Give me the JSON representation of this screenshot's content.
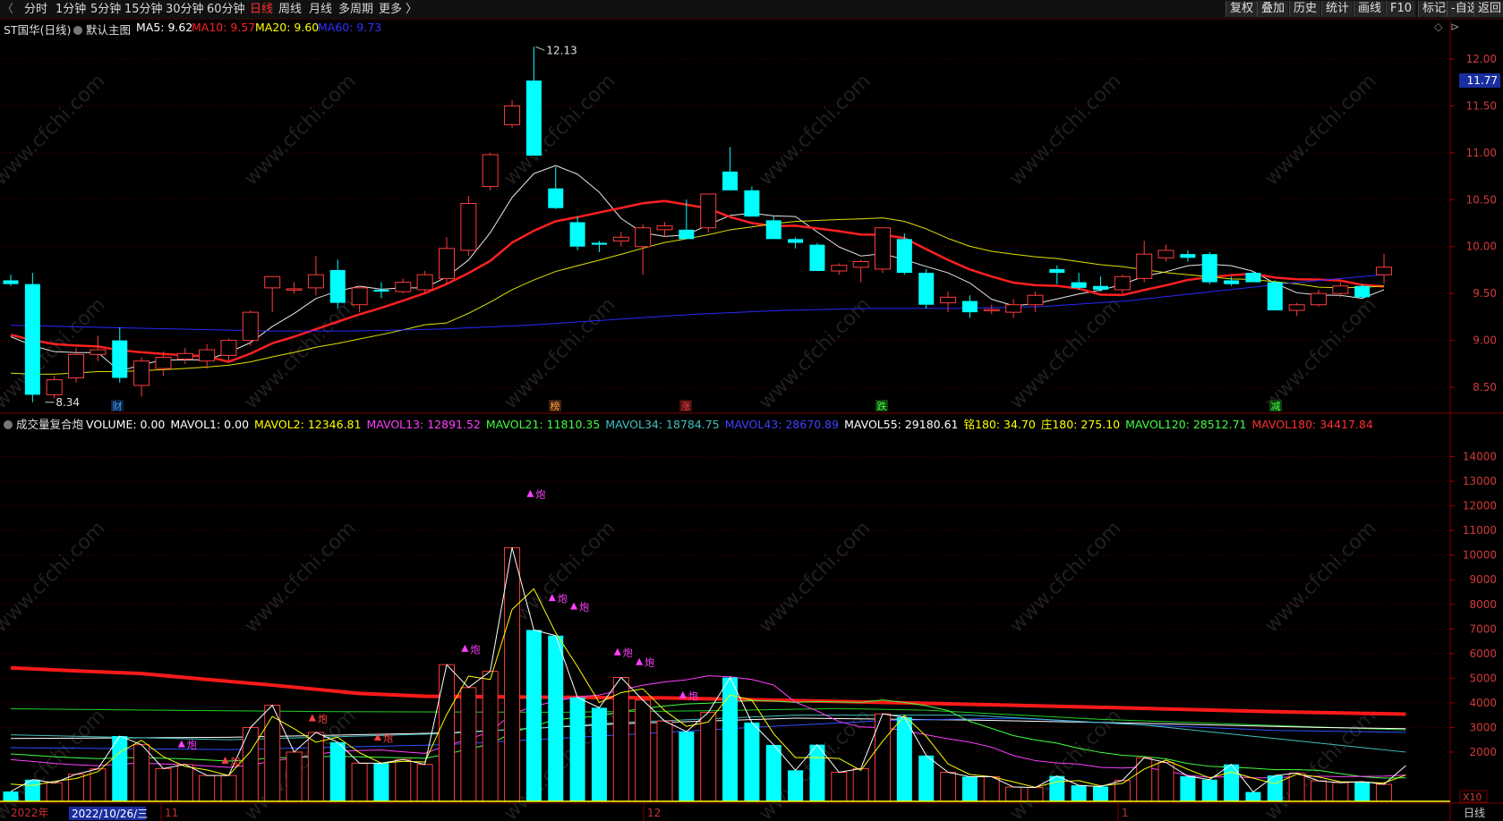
{
  "toolbar": {
    "periods": [
      "分时",
      "1分钟",
      "5分钟",
      "15分钟",
      "30分钟",
      "60分钟",
      "日线",
      "周线",
      "月线",
      "多周期",
      "更多 〉"
    ],
    "active_period": "日线",
    "right_buttons": [
      "复权",
      "叠加",
      "历史",
      "统计",
      "画线",
      "F10",
      "标记",
      "-自选",
      "返回"
    ]
  },
  "main": {
    "title": "ST国华(日线)",
    "indicator": "默认主图",
    "ma": [
      {
        "label": "MA5: 9.62",
        "color": "#ffffff"
      },
      {
        "label": "MA10: 9.57",
        "color": "#ff2020"
      },
      {
        "label": "MA20: 9.60",
        "color": "#ffff00"
      },
      {
        "label": "MA60: 9.73",
        "color": "#3030ff"
      }
    ],
    "high_label": "12.13",
    "low_label": "8.34",
    "last_price": "11.77",
    "price_ticks": [
      "12.00",
      "11.50",
      "11.00",
      "10.50",
      "10.00",
      "9.50",
      "9.00",
      "8.50"
    ],
    "events": [
      {
        "text": "财",
        "color": "#40a0ff",
        "bg": "#102040"
      },
      {
        "text": "榜",
        "color": "#ffa040",
        "bg": "#402010"
      },
      {
        "text": "涨",
        "color": "#ff4040",
        "bg": "#401010"
      },
      {
        "text": "跌",
        "color": "#40ff40",
        "bg": "#104010"
      },
      {
        "text": "减",
        "color": "#40ff40",
        "bg": "#104010"
      }
    ]
  },
  "volume": {
    "title": "成交量复合炮",
    "values": [
      {
        "label": "VOLUME: 0.00",
        "color": "#ffffff"
      },
      {
        "label": "MAVOL1: 0.00",
        "color": "#ffffff"
      },
      {
        "label": "MAVOL2: 12346.81",
        "color": "#ffff00"
      },
      {
        "label": "MAVOL13: 12891.52",
        "color": "#ff40ff"
      },
      {
        "label": "MAVOL21: 11810.35",
        "color": "#40ff40"
      },
      {
        "label": "MAVOL34: 18784.75",
        "color": "#40c0c0"
      },
      {
        "label": "MAVOL43: 28670.89",
        "color": "#4040ff"
      },
      {
        "label": "MAVOL55: 29180.61",
        "color": "#ffffff"
      },
      {
        "label": "铭180: 34.70",
        "color": "#ffff00"
      },
      {
        "label": "庄180: 275.10",
        "color": "#ffff00"
      },
      {
        "label": "MAVOL120: 28512.71",
        "color": "#40ff40"
      },
      {
        "label": "MAVOL180: 34417.84",
        "color": "#ff3030"
      }
    ],
    "ticks": [
      "14000",
      "13000",
      "12000",
      "11000",
      "10000",
      "9000",
      "8000",
      "7000",
      "6000",
      "5000",
      "4000",
      "3000",
      "2000"
    ],
    "multiplier": "X10",
    "marker_labels": [
      "炮",
      "加",
      "炮",
      "炮",
      "炮",
      "炮",
      "炮",
      "炮",
      "炮",
      "炮",
      "炮"
    ]
  },
  "dates": {
    "year": "2022年",
    "cursor": "2022/10/26/三",
    "months": [
      "11",
      "12",
      "1"
    ],
    "period": "日线"
  },
  "watermark": "www.cfchi.com",
  "chart_data": {
    "type": "candlestick",
    "bars": [
      {
        "o": 9.64,
        "h": 9.7,
        "l": 9.58,
        "c": 9.6
      },
      {
        "o": 9.6,
        "h": 9.72,
        "l": 8.34,
        "c": 8.42
      },
      {
        "o": 8.42,
        "h": 8.62,
        "l": 8.38,
        "c": 8.58
      },
      {
        "o": 8.6,
        "h": 8.92,
        "l": 8.55,
        "c": 8.85
      },
      {
        "o": 8.85,
        "h": 9.05,
        "l": 8.78,
        "c": 8.9
      },
      {
        "o": 9.0,
        "h": 9.14,
        "l": 8.55,
        "c": 8.6
      },
      {
        "o": 8.52,
        "h": 8.82,
        "l": 8.4,
        "c": 8.78
      },
      {
        "o": 8.7,
        "h": 8.88,
        "l": 8.62,
        "c": 8.82
      },
      {
        "o": 8.8,
        "h": 8.92,
        "l": 8.75,
        "c": 8.86
      },
      {
        "o": 8.78,
        "h": 8.96,
        "l": 8.7,
        "c": 8.9
      },
      {
        "o": 8.84,
        "h": 9.02,
        "l": 8.78,
        "c": 9.0
      },
      {
        "o": 9.0,
        "h": 9.32,
        "l": 8.94,
        "c": 9.3
      },
      {
        "o": 9.56,
        "h": 9.68,
        "l": 9.3,
        "c": 9.68
      },
      {
        "o": 9.54,
        "h": 9.62,
        "l": 9.5,
        "c": 9.55
      },
      {
        "o": 9.56,
        "h": 9.9,
        "l": 9.48,
        "c": 9.7
      },
      {
        "o": 9.75,
        "h": 9.86,
        "l": 9.34,
        "c": 9.4
      },
      {
        "o": 9.38,
        "h": 9.58,
        "l": 9.3,
        "c": 9.56
      },
      {
        "o": 9.54,
        "h": 9.62,
        "l": 9.45,
        "c": 9.52
      },
      {
        "o": 9.52,
        "h": 9.66,
        "l": 9.5,
        "c": 9.62
      },
      {
        "o": 9.54,
        "h": 9.74,
        "l": 9.5,
        "c": 9.7
      },
      {
        "o": 9.66,
        "h": 10.1,
        "l": 9.6,
        "c": 9.98
      },
      {
        "o": 9.96,
        "h": 10.54,
        "l": 9.9,
        "c": 10.46
      },
      {
        "o": 10.64,
        "h": 11.0,
        "l": 10.6,
        "c": 10.98
      },
      {
        "o": 11.3,
        "h": 11.56,
        "l": 11.26,
        "c": 11.5
      },
      {
        "o": 11.77,
        "h": 12.13,
        "l": 10.97,
        "c": 10.97
      },
      {
        "o": 10.62,
        "h": 10.85,
        "l": 10.4,
        "c": 10.41
      },
      {
        "o": 10.26,
        "h": 10.32,
        "l": 9.96,
        "c": 10.0
      },
      {
        "o": 10.04,
        "h": 10.06,
        "l": 9.94,
        "c": 10.02
      },
      {
        "o": 10.06,
        "h": 10.16,
        "l": 10.0,
        "c": 10.1
      },
      {
        "o": 10.0,
        "h": 10.24,
        "l": 9.7,
        "c": 10.2
      },
      {
        "o": 10.18,
        "h": 10.26,
        "l": 10.1,
        "c": 10.22
      },
      {
        "o": 10.18,
        "h": 10.5,
        "l": 10.08,
        "c": 10.08
      },
      {
        "o": 10.2,
        "h": 10.52,
        "l": 10.15,
        "c": 10.56
      },
      {
        "o": 10.8,
        "h": 11.06,
        "l": 10.6,
        "c": 10.6
      },
      {
        "o": 10.6,
        "h": 10.64,
        "l": 10.32,
        "c": 10.32
      },
      {
        "o": 10.28,
        "h": 10.32,
        "l": 10.08,
        "c": 10.08
      },
      {
        "o": 10.08,
        "h": 10.1,
        "l": 9.98,
        "c": 10.04
      },
      {
        "o": 10.02,
        "h": 10.04,
        "l": 9.74,
        "c": 9.74
      },
      {
        "o": 9.74,
        "h": 9.82,
        "l": 9.7,
        "c": 9.8
      },
      {
        "o": 9.78,
        "h": 9.86,
        "l": 9.62,
        "c": 9.84
      },
      {
        "o": 9.76,
        "h": 10.18,
        "l": 9.72,
        "c": 10.2
      },
      {
        "o": 10.08,
        "h": 10.14,
        "l": 9.7,
        "c": 9.72
      },
      {
        "o": 9.72,
        "h": 9.76,
        "l": 9.34,
        "c": 9.38
      },
      {
        "o": 9.4,
        "h": 9.52,
        "l": 9.3,
        "c": 9.46
      },
      {
        "o": 9.42,
        "h": 9.48,
        "l": 9.24,
        "c": 9.3
      },
      {
        "o": 9.32,
        "h": 9.38,
        "l": 9.28,
        "c": 9.33
      },
      {
        "o": 9.3,
        "h": 9.44,
        "l": 9.24,
        "c": 9.38
      },
      {
        "o": 9.38,
        "h": 9.52,
        "l": 9.3,
        "c": 9.48
      },
      {
        "o": 9.76,
        "h": 9.8,
        "l": 9.6,
        "c": 9.72
      },
      {
        "o": 9.62,
        "h": 9.72,
        "l": 9.54,
        "c": 9.56
      },
      {
        "o": 9.58,
        "h": 9.68,
        "l": 9.52,
        "c": 9.54
      },
      {
        "o": 9.54,
        "h": 9.7,
        "l": 9.5,
        "c": 9.68
      },
      {
        "o": 9.66,
        "h": 10.06,
        "l": 9.62,
        "c": 9.92
      },
      {
        "o": 9.88,
        "h": 10.02,
        "l": 9.84,
        "c": 9.96
      },
      {
        "o": 9.92,
        "h": 9.96,
        "l": 9.84,
        "c": 9.88
      },
      {
        "o": 9.92,
        "h": 9.94,
        "l": 9.6,
        "c": 9.62
      },
      {
        "o": 9.64,
        "h": 9.68,
        "l": 9.58,
        "c": 9.6
      },
      {
        "o": 9.72,
        "h": 9.74,
        "l": 9.62,
        "c": 9.62
      },
      {
        "o": 9.62,
        "h": 9.64,
        "l": 9.32,
        "c": 9.32
      },
      {
        "o": 9.32,
        "h": 9.4,
        "l": 9.26,
        "c": 9.38
      },
      {
        "o": 9.38,
        "h": 9.54,
        "l": 9.36,
        "c": 9.5
      },
      {
        "o": 9.5,
        "h": 9.62,
        "l": 9.46,
        "c": 9.58
      },
      {
        "o": 9.58,
        "h": 9.6,
        "l": 9.44,
        "c": 9.46
      },
      {
        "o": 9.7,
        "h": 9.92,
        "l": 9.6,
        "c": 9.78
      }
    ],
    "volumes": [
      400,
      880,
      750,
      1100,
      1320,
      2650,
      2300,
      1330,
      1500,
      1050,
      1050,
      3000,
      3900,
      2000,
      2800,
      2400,
      1550,
      1550,
      1700,
      1500,
      5550,
      4620,
      5280,
      10300,
      6960,
      6730,
      4220,
      3800,
      5030,
      4110,
      3260,
      2830,
      3610,
      5030,
      3200,
      2290,
      1260,
      2300,
      1180,
      1330,
      3550,
      3420,
      1860,
      1180,
      1000,
      1000,
      580,
      560,
      1030,
      650,
      600,
      850,
      1770,
      1580,
      1020,
      880,
      1500,
      380,
      1050,
      1150,
      830,
      760,
      800,
      690,
      1450
    ]
  }
}
